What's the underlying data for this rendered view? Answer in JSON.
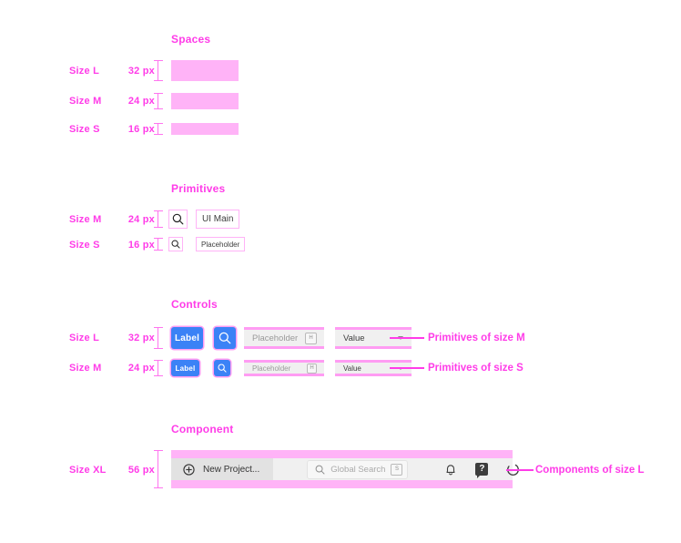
{
  "sections": [
    {
      "title": "Spaces",
      "rows": [
        {
          "size": "Size L",
          "px": "32 px"
        },
        {
          "size": "Size M",
          "px": "24 px"
        },
        {
          "size": "Size S",
          "px": "16 px"
        }
      ]
    },
    {
      "title": "Primitives",
      "rows": [
        {
          "size": "Size M",
          "px": "24 px",
          "text": "UI Main"
        },
        {
          "size": "Size S",
          "px": "16 px",
          "text": "Placeholder"
        }
      ]
    },
    {
      "title": "Controls",
      "rows": [
        {
          "size": "Size L",
          "px": "32 px",
          "button_label": "Label",
          "placeholder": "Placeholder",
          "kbd": "H",
          "value": "Value",
          "note": "Primitives of size M"
        },
        {
          "size": "Size M",
          "px": "24 px",
          "button_label": "Label",
          "placeholder": "Placeholder",
          "kbd": "H",
          "value": "Value",
          "note": "Primitives of size S"
        }
      ]
    },
    {
      "title": "Component",
      "rows": [
        {
          "size": "Size XL",
          "px": "56 px",
          "new_project_label": "New Project...",
          "global_search_placeholder": "Global Search",
          "global_search_kbd": "S",
          "help_glyph": "?",
          "note": "Components of size L"
        }
      ]
    }
  ],
  "icons": {
    "search": "search-icon",
    "plus_circle": "plus-circle-icon",
    "bell": "bell-icon",
    "help": "help-icon",
    "spinner": "spinner-icon"
  },
  "colors": {
    "accent_pink": "#ff3ce8",
    "pink_fill": "#ffb3f7",
    "pink_outline": "#ff9cf3",
    "blue_button": "#3b82f6",
    "field_grey": "#f0f0f0",
    "text_dark": "#3d3d3d",
    "text_muted": "#9a9a9a"
  }
}
